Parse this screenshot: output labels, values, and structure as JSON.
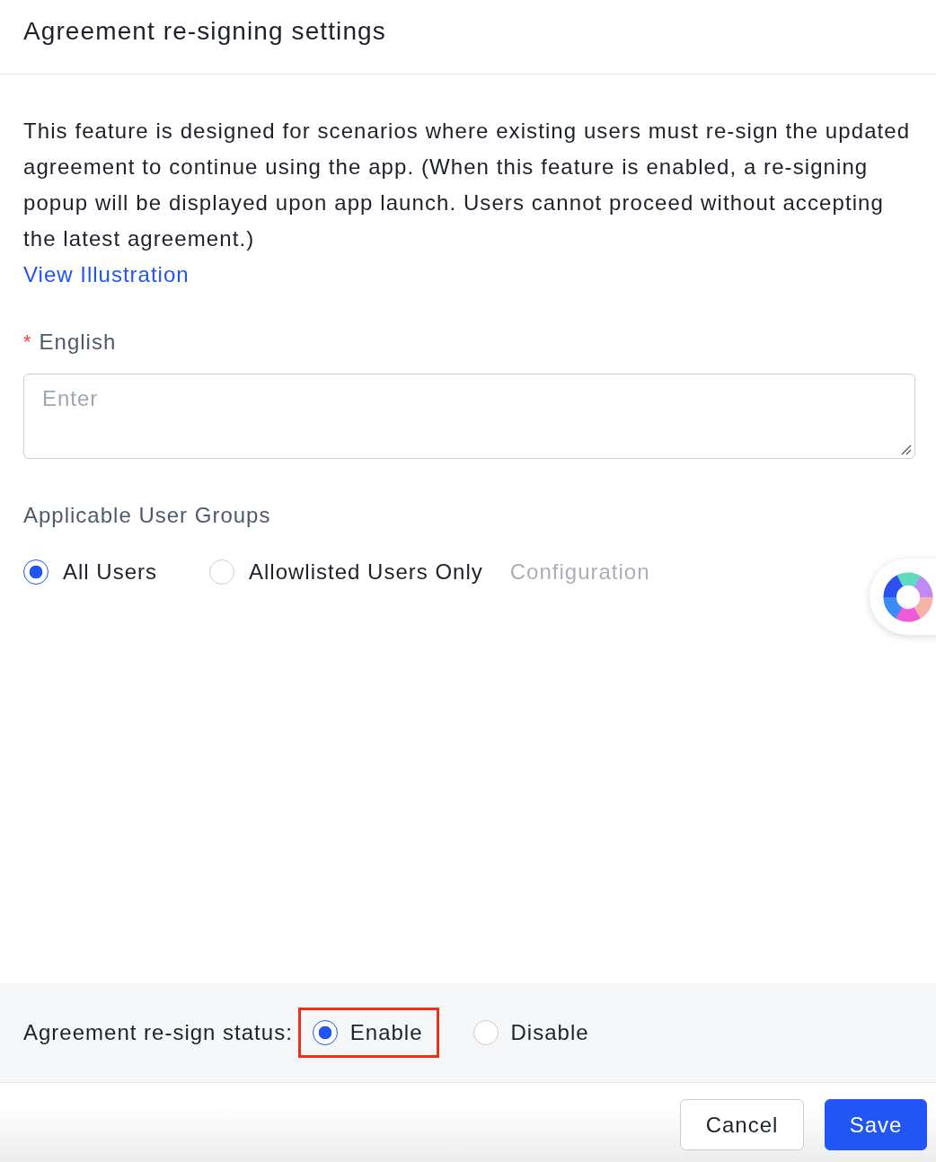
{
  "dialog": {
    "title": "Agreement re-signing settings"
  },
  "description": {
    "text": "This feature is designed for scenarios where existing users must re-sign the updated agreement to continue using the app. (When this feature is enabled, a re-signing popup will be displayed upon app launch. Users cannot proceed without accepting the latest agreement.)",
    "link": "View Illustration"
  },
  "english_field": {
    "required_mark": "*",
    "label": "English",
    "placeholder": "Enter"
  },
  "user_groups": {
    "label": "Applicable User Groups",
    "options": [
      {
        "label": "All Users",
        "selected": true
      },
      {
        "label": "Allowlisted Users Only",
        "selected": false
      }
    ],
    "configuration_link": {
      "label": "Configuration",
      "disabled": true
    }
  },
  "status_bar": {
    "label": "Agreement re-sign status:",
    "options": [
      {
        "label": "Enable",
        "selected": true,
        "highlighted": true
      },
      {
        "label": "Disable",
        "selected": false,
        "highlighted": false
      }
    ]
  },
  "buttons": [
    {
      "label": "Cancel",
      "kind": "secondary"
    },
    {
      "label": "Save",
      "kind": "primary"
    }
  ]
}
